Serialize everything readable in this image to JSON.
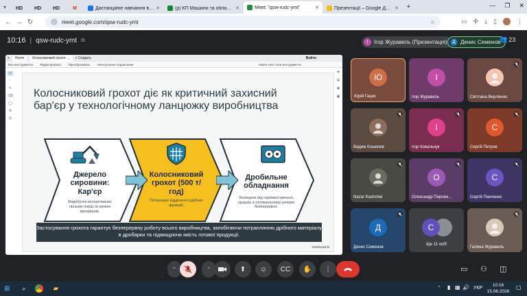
{
  "browser": {
    "tabs": [
      {
        "label": "HD",
        "kind": "short"
      },
      {
        "label": "HD",
        "kind": "short"
      },
      {
        "label": "HD",
        "kind": "short"
      },
      {
        "label": "M",
        "kind": "short"
      },
      {
        "label": "Дистанційне навчання в ВСП",
        "kind": "wide"
      },
      {
        "label": "(р) КП Машини та обладнання",
        "kind": "wide"
      },
      {
        "label": "Meet: \"qsw-rudc-ymt\"",
        "kind": "active"
      },
      {
        "label": "Презентації – Google Диск",
        "kind": "wide"
      }
    ],
    "url": "meet.google.com/qsw-rudc-ymt"
  },
  "meet": {
    "time": "10:16",
    "code": "qsw-rudc-ymt",
    "presenting_label": "Ігор Журавель (Презентація)",
    "self_label": "Денис Семенов",
    "participant_count": "23"
  },
  "viewer": {
    "tab_home": "Home",
    "tab_doc": "Колосниковий грохот ...",
    "tab_new": "+ Создать",
    "signin": "Войти",
    "menu": [
      "Все инструменты",
      "Редактировать",
      "Преобразовать",
      "Электронное подписание"
    ],
    "search_placeholder": "Найти текст или инструменты"
  },
  "slide": {
    "title": "Колосниковий грохот діє як критичний захисний бар'єр у технологічному ланцюжку виробництва",
    "step1_title": "Джерело сировини: Кар'єр",
    "step1_desc": "Видобуток несортованих гірських порід та сипких матеріалів.",
    "step2_title": "Колосниковий грохот (500 т/год)",
    "step2_desc": "Попереднє відділення дрібних фракцій.",
    "step3_title": "Дробильне обладнання",
    "step3_desc": "Захищене від перевантаження, працює в оптимальному режимі безперервно.",
    "footer": "Застосування грохота гарантує безперервну роботу всього виробництва, запобігаючи потраплянню дрібного матеріалу в дробарки та підвищуючи якість готової продукції.",
    "brand": "NotebookLM"
  },
  "participants": [
    {
      "name": "Юрій Гацик",
      "initial": "Ю",
      "tile_color": "#7a4a3c",
      "avatar_color": "#d06e48",
      "muted": false,
      "active": true
    },
    {
      "name": "Ігор Журавель",
      "initial": "І",
      "tile_color": "#6e3b6b",
      "avatar_color": "#c14ea9",
      "muted": false,
      "active": false
    },
    {
      "name": "Світлана Верліенко",
      "initial": "",
      "tile_color": "#6a4740",
      "avatar_color": "#f2c6b5",
      "muted": true,
      "active": false
    },
    {
      "name": "Вадим Кошелев",
      "initial": "",
      "tile_color": "#5b4a3f",
      "avatar_color": "#8c6f5a",
      "muted": true,
      "active": false
    },
    {
      "name": "Ігор Ковальчук",
      "initial": "І",
      "tile_color": "#7b2d50",
      "avatar_color": "#e0408a",
      "muted": true,
      "active": false
    },
    {
      "name": "Сергій Петров",
      "initial": "С",
      "tile_color": "#7d3a28",
      "avatar_color": "#e2582d",
      "muted": true,
      "active": false
    },
    {
      "name": "Nazar Kashchei",
      "initial": "",
      "tile_color": "#4a4a44",
      "avatar_color": "#6b6b60",
      "muted": true,
      "active": false
    },
    {
      "name": "Олександр Пирожк…",
      "initial": "О",
      "tile_color": "#5b3c66",
      "avatar_color": "#9a5ab5",
      "muted": true,
      "active": false
    },
    {
      "name": "Сергій Панченко",
      "initial": "С",
      "tile_color": "#3e3565",
      "avatar_color": "#6d55c2",
      "muted": true,
      "active": false
    },
    {
      "name": "Денис Семенов",
      "initial": "Д",
      "tile_color": "#24476b",
      "avatar_color": "#1d6bb8",
      "muted": true,
      "active": false
    },
    {
      "name": "Ще 11 осіб",
      "initial": "С",
      "tile_color": "#3c4043",
      "avatar_color": "#5f51c0",
      "muted": false,
      "active": false
    },
    {
      "name": "Галина Журавель",
      "initial": "",
      "tile_color": "#6b5d55",
      "avatar_color": "#d9c7b8",
      "muted": true,
      "active": false
    }
  ],
  "taskbar": {
    "lang": "УКР",
    "time": "10:16",
    "date": "15.06.2026"
  }
}
